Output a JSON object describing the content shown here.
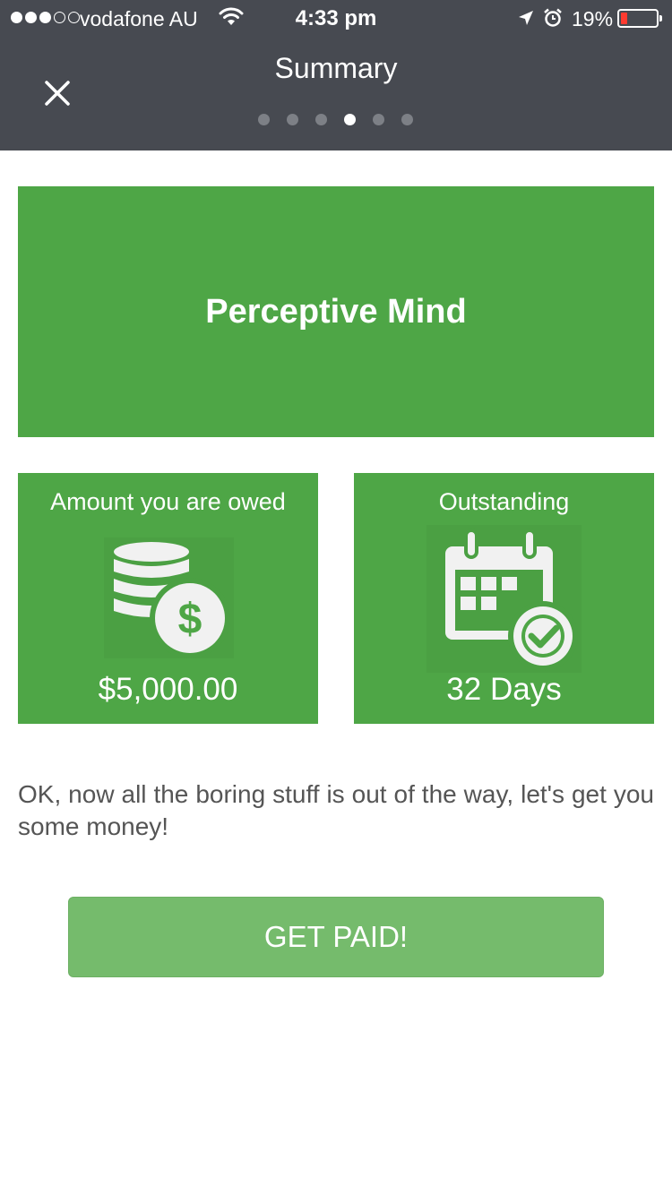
{
  "status_bar": {
    "carrier": "vodafone AU",
    "time": "4:33 pm",
    "battery_percent": "19%",
    "battery_level": 0.19,
    "signal_strength": 3,
    "signal_max": 5
  },
  "header": {
    "title": "Summary",
    "close_icon": "close-icon",
    "page_count": 6,
    "active_page": 4
  },
  "banner": {
    "name": "Perceptive Mind"
  },
  "cards": {
    "owed": {
      "label": "Amount you are owed",
      "value": "$5,000.00",
      "icon": "coins-dollar-icon"
    },
    "outstanding": {
      "label": "Outstanding",
      "value": "32 Days",
      "icon": "calendar-check-icon"
    }
  },
  "message": "OK, now all the boring stuff is out of the way, let's get you some money!",
  "cta": {
    "label": "GET PAID!"
  },
  "colors": {
    "header_bg": "#474a51",
    "green": "#4ea646",
    "button_green": "#75bb6c",
    "battery_low": "#ff3b30"
  }
}
